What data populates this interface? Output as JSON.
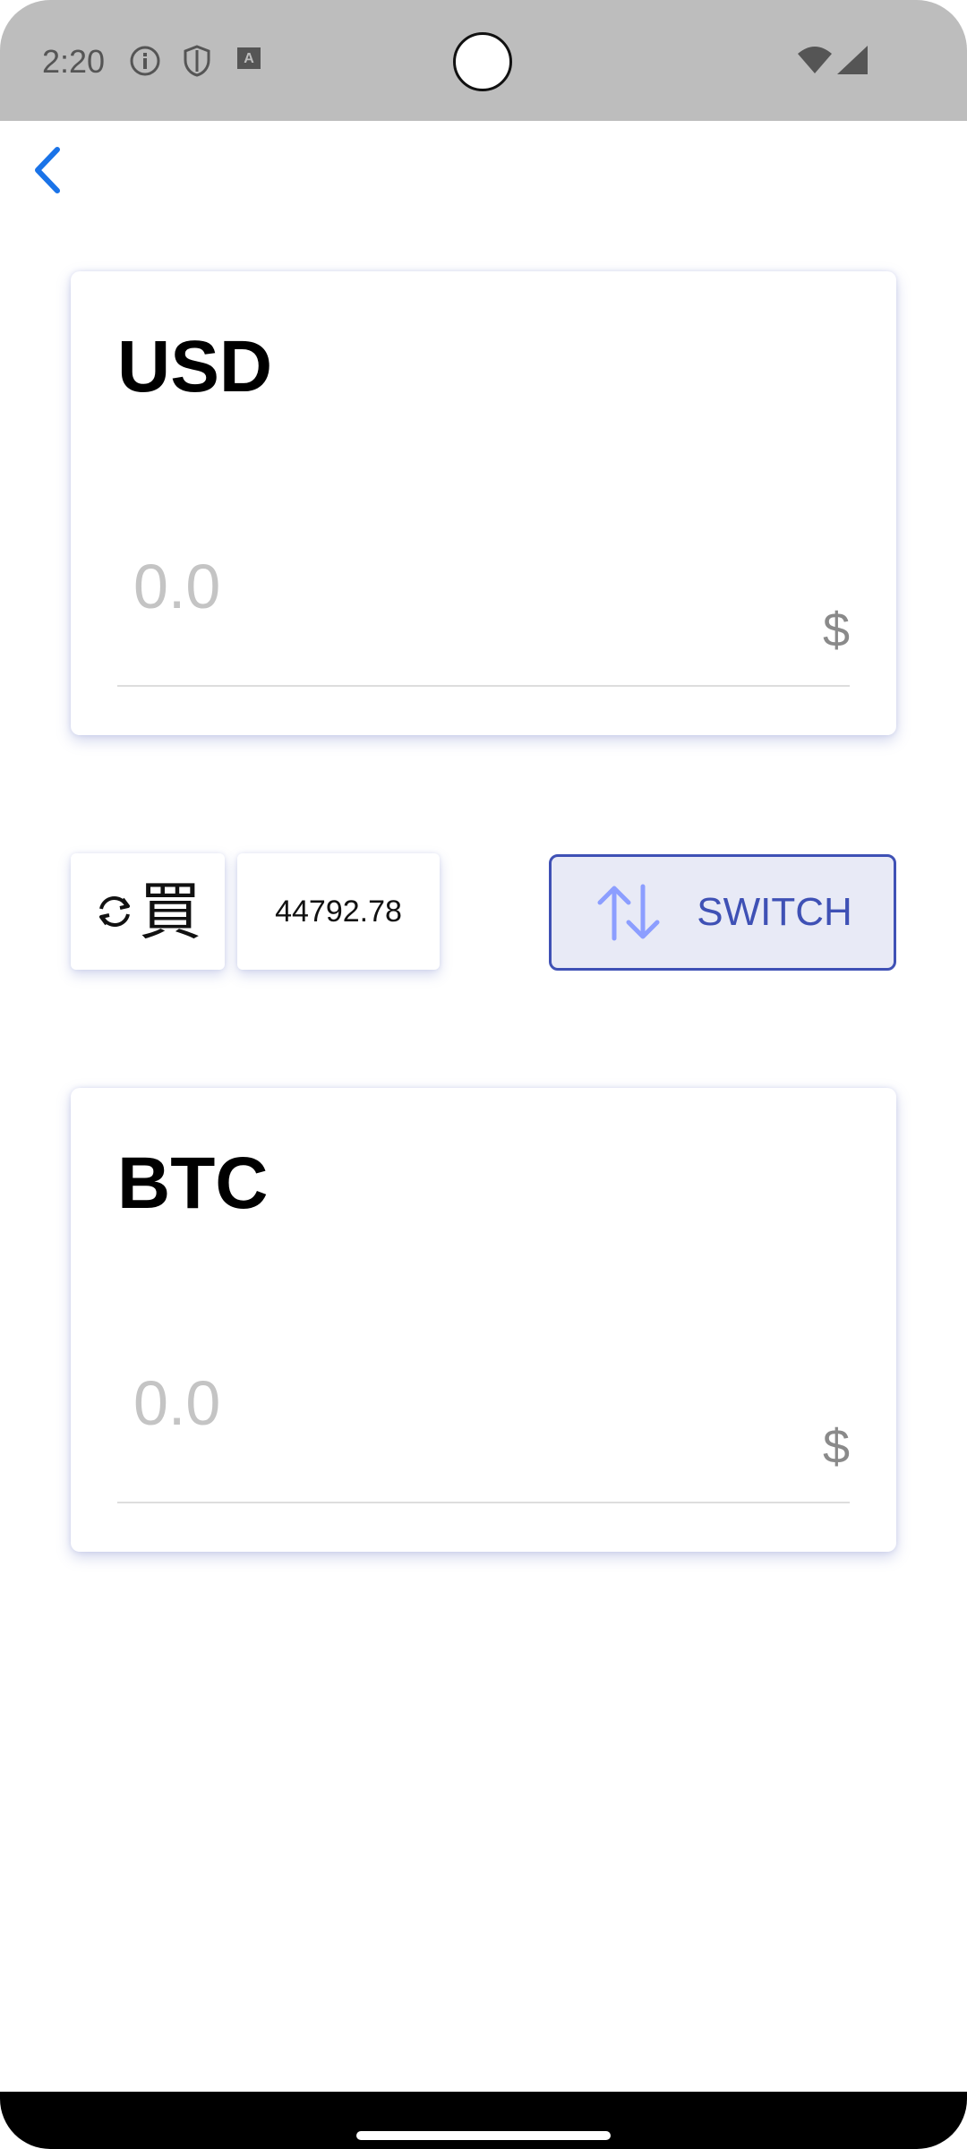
{
  "status_bar": {
    "time": "2:20",
    "icons": [
      "info-icon",
      "shield-icon",
      "font-icon",
      "wifi-icon",
      "signal-icon"
    ]
  },
  "nav": {
    "back_icon": "chevron-left-icon",
    "accent": "#1a73e8"
  },
  "from_card": {
    "title": "USD",
    "amount_placeholder": "0.0",
    "currency_symbol": "$"
  },
  "controls": {
    "refresh_icon": "refresh-icon",
    "buy_label": "買",
    "rate": "44792.78",
    "switch_label": "SWITCH",
    "switch_icon": "swap-vertical-icon",
    "switch_color": "#3f51b5",
    "switch_bg": "#e8eaf6"
  },
  "to_card": {
    "title": "BTC",
    "amount_placeholder": "0.0",
    "currency_symbol": "$"
  }
}
